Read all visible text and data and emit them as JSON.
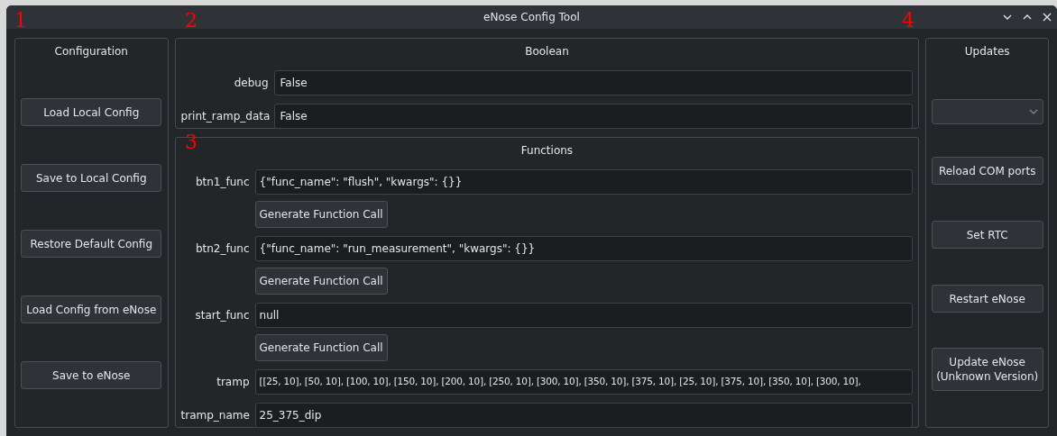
{
  "window": {
    "title": "eNose Config Tool"
  },
  "annotations": [
    "1",
    "2",
    "3",
    "4"
  ],
  "configuration": {
    "title": "Configuration",
    "buttons": [
      "Load Local Config",
      "Save to Local Config",
      "Restore Default Config",
      "Load Config from eNose",
      "Save to eNose"
    ]
  },
  "boolean": {
    "title": "Boolean",
    "fields": [
      {
        "label": "debug",
        "value": "False"
      },
      {
        "label": "print_ramp_data",
        "value": "False"
      }
    ]
  },
  "functions": {
    "title": "Functions",
    "fields": [
      {
        "label": "btn1_func",
        "value": "{\"func_name\": \"flush\", \"kwargs\": {}}",
        "button": "Generate Function Call"
      },
      {
        "label": "btn2_func",
        "value": "{\"func_name\": \"run_measurement\", \"kwargs\": {}}",
        "button": "Generate Function Call"
      },
      {
        "label": "start_func",
        "value": "null",
        "button": "Generate Function Call"
      },
      {
        "label": "tramp",
        "value": "[[25, 10], [50, 10], [100, 10], [150, 10], [200, 10], [250, 10], [300, 10], [350, 10], [375, 10], [25, 10], [375, 10], [350, 10], [300, 10],"
      },
      {
        "label": "tramp_name",
        "value": "25_375_dip"
      }
    ]
  },
  "updates": {
    "title": "Updates",
    "buttons": [
      "Reload COM ports",
      "Set RTC",
      "Restart eNose",
      "Update eNose\n(Unknown Version)"
    ]
  }
}
